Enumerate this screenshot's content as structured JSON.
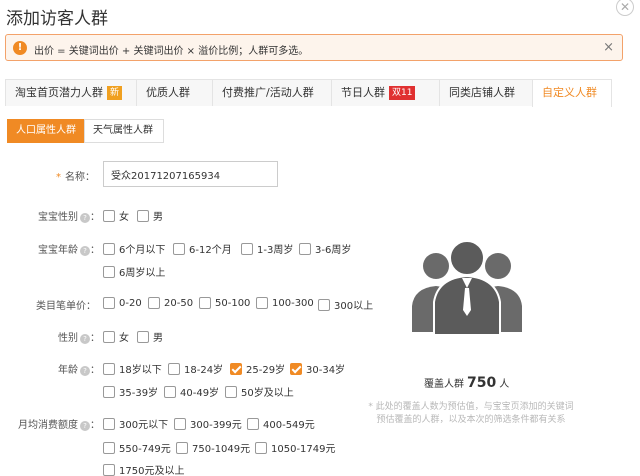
{
  "dialog": {
    "title": "添加访客人群",
    "close_glyph": "✕"
  },
  "notice": {
    "icon": "!",
    "text": "出价 = 关键词出价 + 关键词出价 × 溢价比例；人群可多选。",
    "close": "×"
  },
  "tabs": [
    {
      "label": "淘宝首页潜力人群",
      "badge": "新",
      "badge_type": "new"
    },
    {
      "label": "优质人群"
    },
    {
      "label": "付费推广/活动人群"
    },
    {
      "label": "节日人群",
      "badge": "双11",
      "badge_type": "dbl"
    },
    {
      "label": "同类店铺人群"
    },
    {
      "label": "自定义人群",
      "active": true
    }
  ],
  "subtabs": [
    {
      "label": "人口属性人群",
      "active": true
    },
    {
      "label": "天气属性人群"
    }
  ],
  "form": {
    "name": {
      "required_mark": "*",
      "label": "名称：",
      "value": "受众20171207165934"
    },
    "baby_gender": {
      "label": "宝宝性别",
      "colon": "：",
      "options": [
        {
          "label": "女",
          "checked": false
        },
        {
          "label": "男",
          "checked": false
        }
      ]
    },
    "baby_age": {
      "label": "宝宝年龄",
      "colon": "：",
      "options": [
        {
          "label": "6个月以下",
          "checked": false
        },
        {
          "label": "6-12个月",
          "checked": false
        },
        {
          "label": "1-3周岁",
          "checked": false
        },
        {
          "label": "3-6周岁",
          "checked": false
        },
        {
          "label": "6周岁以上",
          "checked": false
        }
      ]
    },
    "category_price": {
      "label": "类目笔单价：",
      "options": [
        {
          "label": "0-20",
          "checked": false
        },
        {
          "label": "20-50",
          "checked": false
        },
        {
          "label": "50-100",
          "checked": false
        },
        {
          "label": "100-300",
          "checked": false
        },
        {
          "label": "300以上",
          "checked": false
        }
      ]
    },
    "gender": {
      "label": "性别",
      "colon": "：",
      "options": [
        {
          "label": "女",
          "checked": false
        },
        {
          "label": "男",
          "checked": false
        }
      ]
    },
    "age": {
      "label": "年龄",
      "colon": "：",
      "options": [
        {
          "label": "18岁以下",
          "checked": false
        },
        {
          "label": "18-24岁",
          "checked": false
        },
        {
          "label": "25-29岁",
          "checked": true
        },
        {
          "label": "30-34岁",
          "checked": true
        },
        {
          "label": "35-39岁",
          "checked": false
        },
        {
          "label": "40-49岁",
          "checked": false
        },
        {
          "label": "50岁及以上",
          "checked": false
        }
      ]
    },
    "monthly_spend": {
      "label": "月均消费额度",
      "colon": "：",
      "options": [
        {
          "label": "300元以下",
          "checked": false
        },
        {
          "label": "300-399元",
          "checked": false
        },
        {
          "label": "400-549元",
          "checked": false
        },
        {
          "label": "550-749元",
          "checked": false
        },
        {
          "label": "750-1049元",
          "checked": false
        },
        {
          "label": "1050-1749元",
          "checked": false
        },
        {
          "label": "1750元及以上",
          "checked": false
        }
      ]
    }
  },
  "coverage": {
    "prefix": "覆盖人群",
    "count": "750",
    "unit": "人",
    "note": "* 此处的覆盖人数为预估值，与宝宝页添加的关键词预估覆盖的人群，以及本次的筛选条件都有关系"
  },
  "colors": {
    "accent": "#f08a24",
    "badge_new": "#f0a020",
    "badge_double11": "#e03030",
    "people_icon": "#5b5b5b"
  }
}
